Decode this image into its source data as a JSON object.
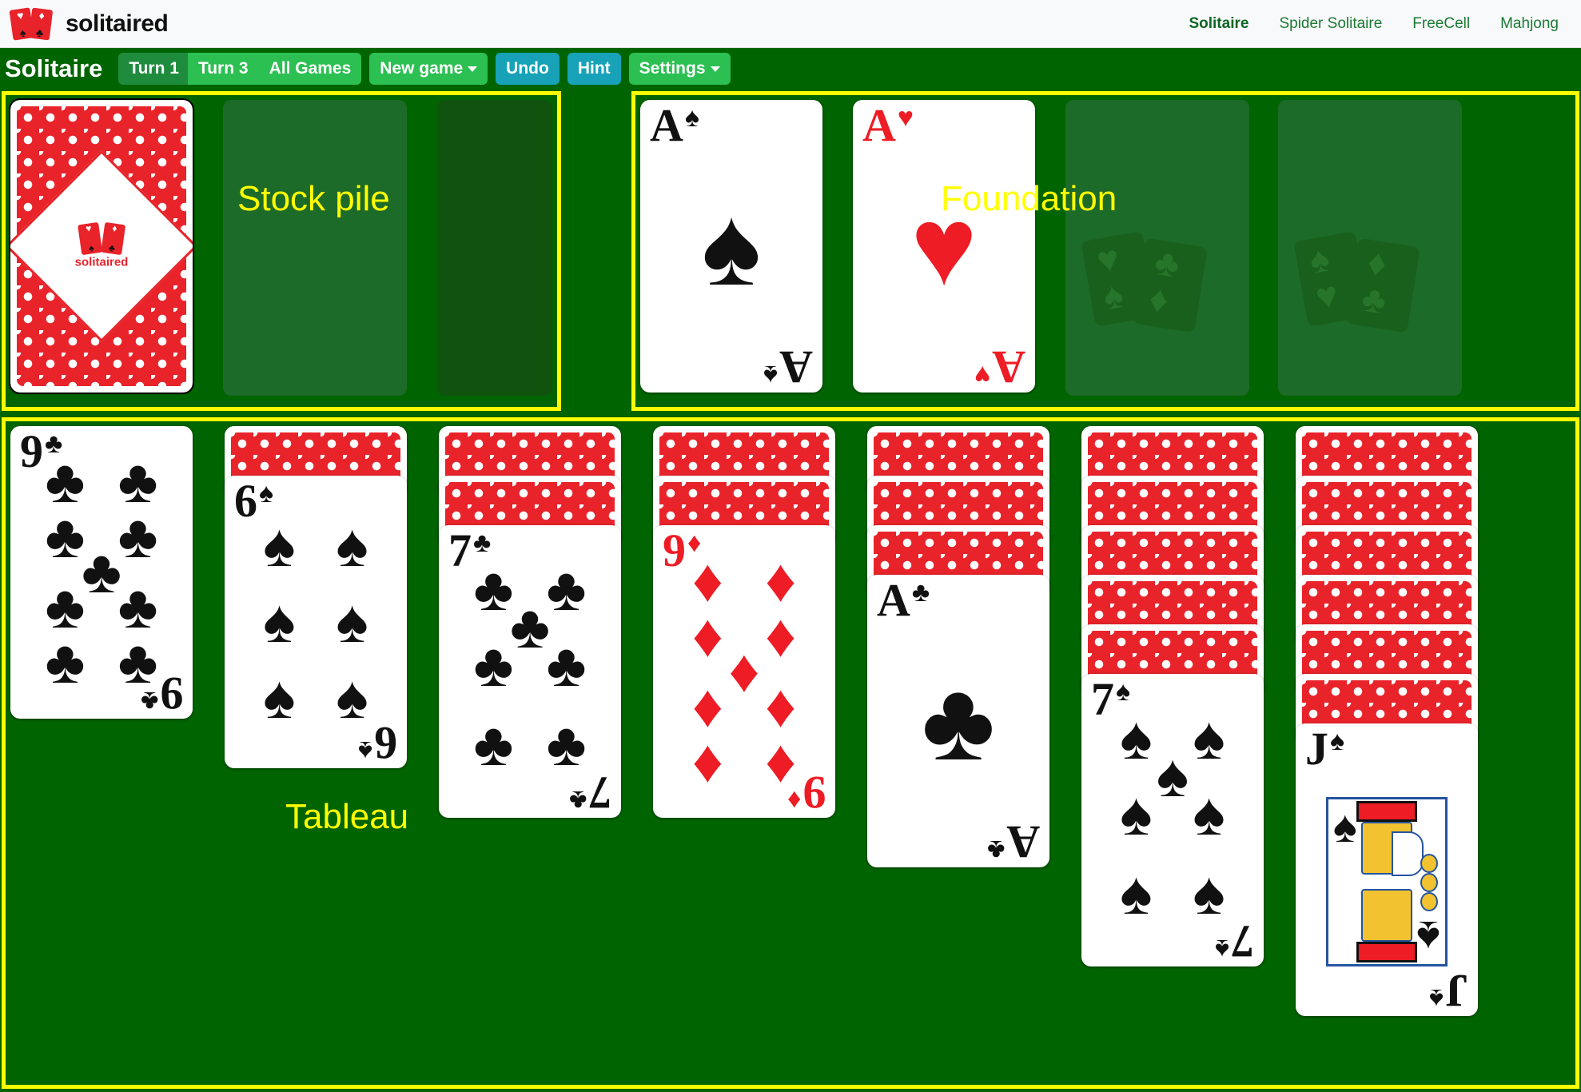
{
  "topnav": {
    "brand": "solitaired",
    "links": [
      {
        "label": "Solitaire",
        "active": true
      },
      {
        "label": "Spider Solitaire",
        "active": false
      },
      {
        "label": "FreeCell",
        "active": false
      },
      {
        "label": "Mahjong",
        "active": false
      }
    ],
    "colors": {
      "bg": "#f8f9fa",
      "link": "#1a7a33",
      "active": "#0b6623"
    }
  },
  "toolbar": {
    "game_title": "Solitaire",
    "turn1": "Turn 1",
    "turn3": "Turn 3",
    "all_games": "All Games",
    "new_game": "New game",
    "undo": "Undo",
    "hint": "Hint",
    "settings": "Settings",
    "colors": {
      "green": "#2cbf52",
      "green_dim": "#1f8b3d",
      "blue": "#17a2b8"
    }
  },
  "board": {
    "bg": "#006400",
    "highlight_color": "#ffff00",
    "slot_color": "#1d6b28",
    "labels": {
      "stock": "Stock pile",
      "foundation": "Foundation",
      "tableau": "Tableau"
    }
  },
  "stock": {
    "deck_face_down": true,
    "logo_text": "solitaired",
    "waste_empty": true
  },
  "foundation": {
    "piles": [
      {
        "rank": "A",
        "suit": "♠",
        "color": "#111111",
        "empty": false
      },
      {
        "rank": "A",
        "suit": "♥",
        "color": "#ee1c25",
        "empty": false
      },
      {
        "rank": "",
        "suit": "",
        "color": "",
        "empty": true
      },
      {
        "rank": "",
        "suit": "",
        "color": "",
        "empty": true
      }
    ]
  },
  "tableau": {
    "columns": [
      {
        "facedown": 0,
        "rank": "9",
        "suit": "♣",
        "color": "#111111",
        "pip_count": 9
      },
      {
        "facedown": 1,
        "rank": "6",
        "suit": "♠",
        "color": "#111111",
        "pip_count": 6
      },
      {
        "facedown": 2,
        "rank": "7",
        "suit": "♣",
        "color": "#111111",
        "pip_count": 7
      },
      {
        "facedown": 2,
        "rank": "9",
        "suit": "♦",
        "color": "#ee1c25",
        "pip_count": 9
      },
      {
        "facedown": 3,
        "rank": "A",
        "suit": "♣",
        "color": "#111111",
        "pip_count": 1
      },
      {
        "facedown": 5,
        "rank": "7",
        "suit": "♠",
        "color": "#111111",
        "pip_count": 7
      },
      {
        "facedown": 6,
        "rank": "J",
        "suit": "♠",
        "color": "#111111",
        "pip_count": 0,
        "court": true
      }
    ]
  }
}
